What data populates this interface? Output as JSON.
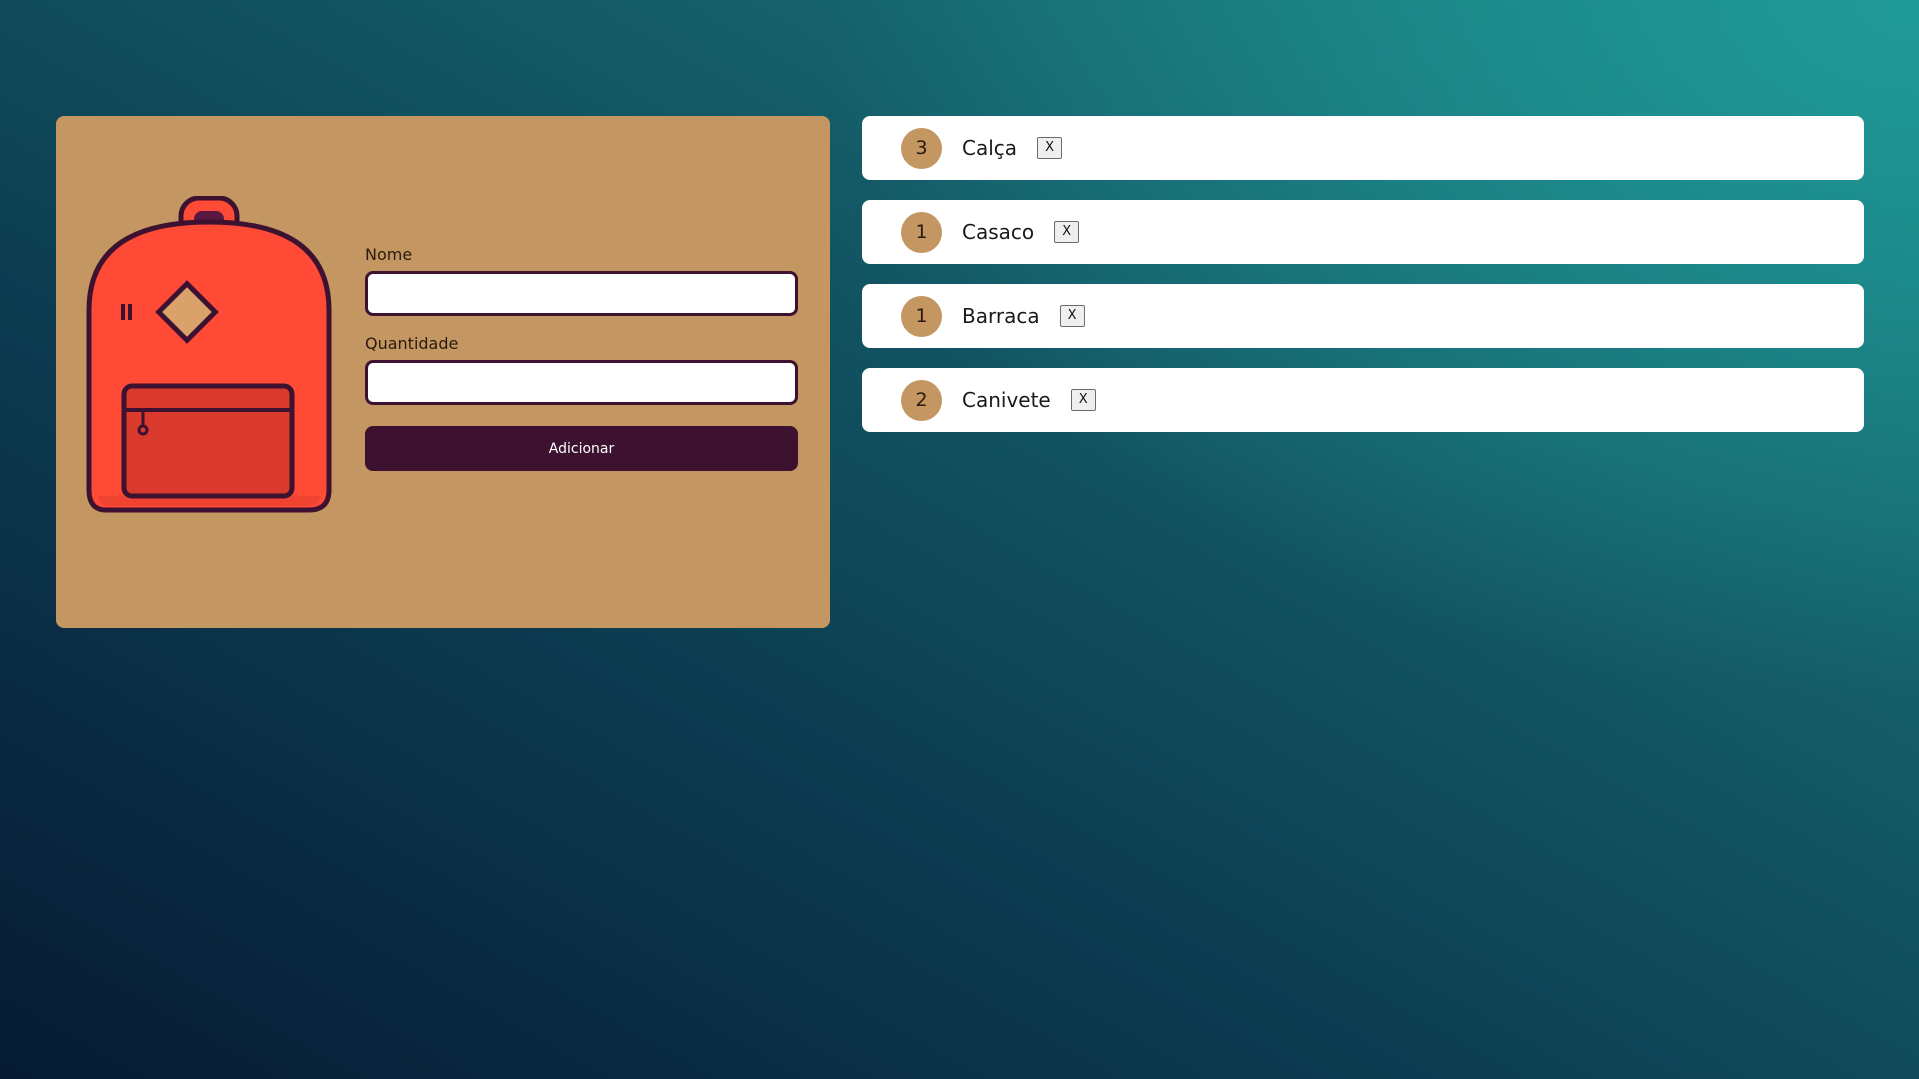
{
  "colors": {
    "card": "#c49661",
    "accent": "#3d1230",
    "backpack_body": "#ff4a36",
    "backpack_pocket": "#d93a2b"
  },
  "form": {
    "illustration": "backpack-icon",
    "name_label": "Nome",
    "name_value": "",
    "quantity_label": "Quantidade",
    "quantity_value": "",
    "submit_label": "Adicionar"
  },
  "items": [
    {
      "quantity": "3",
      "name": "Calça",
      "remove_label": "X"
    },
    {
      "quantity": "1",
      "name": "Casaco",
      "remove_label": "X"
    },
    {
      "quantity": "1",
      "name": "Barraca",
      "remove_label": "X"
    },
    {
      "quantity": "2",
      "name": "Canivete",
      "remove_label": "X"
    }
  ]
}
